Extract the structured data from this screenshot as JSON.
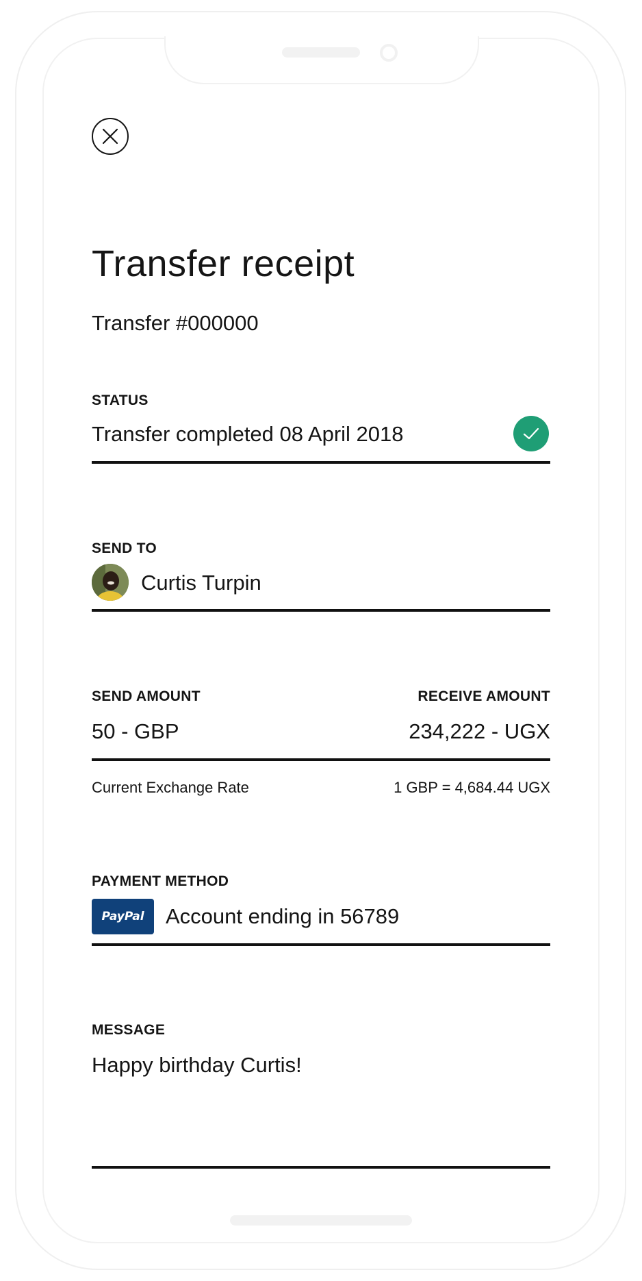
{
  "screen": {
    "close_icon": "close-icon",
    "title": "Transfer receipt",
    "subtitle": "Transfer #000000"
  },
  "status": {
    "label": "STATUS",
    "value": "Transfer completed 08 April 2018",
    "icon": "checkmark-icon",
    "accent": "#1f9e75"
  },
  "send_to": {
    "label": "SEND TO",
    "name": "Curtis Turpin"
  },
  "amounts": {
    "send_label": "SEND AMOUNT",
    "send_value": "50 - GBP",
    "receive_label": "RECEIVE AMOUNT",
    "receive_value": "234,222 - UGX",
    "rate_label": "Current Exchange Rate",
    "rate_value": "1 GBP = 4,684.44 UGX"
  },
  "payment": {
    "label": "PAYMENT METHOD",
    "badge": "PayPal",
    "badge_color": "#10417a",
    "value": "Account ending in 56789"
  },
  "message": {
    "label": "MESSAGE",
    "value": "Happy birthday Curtis!"
  }
}
